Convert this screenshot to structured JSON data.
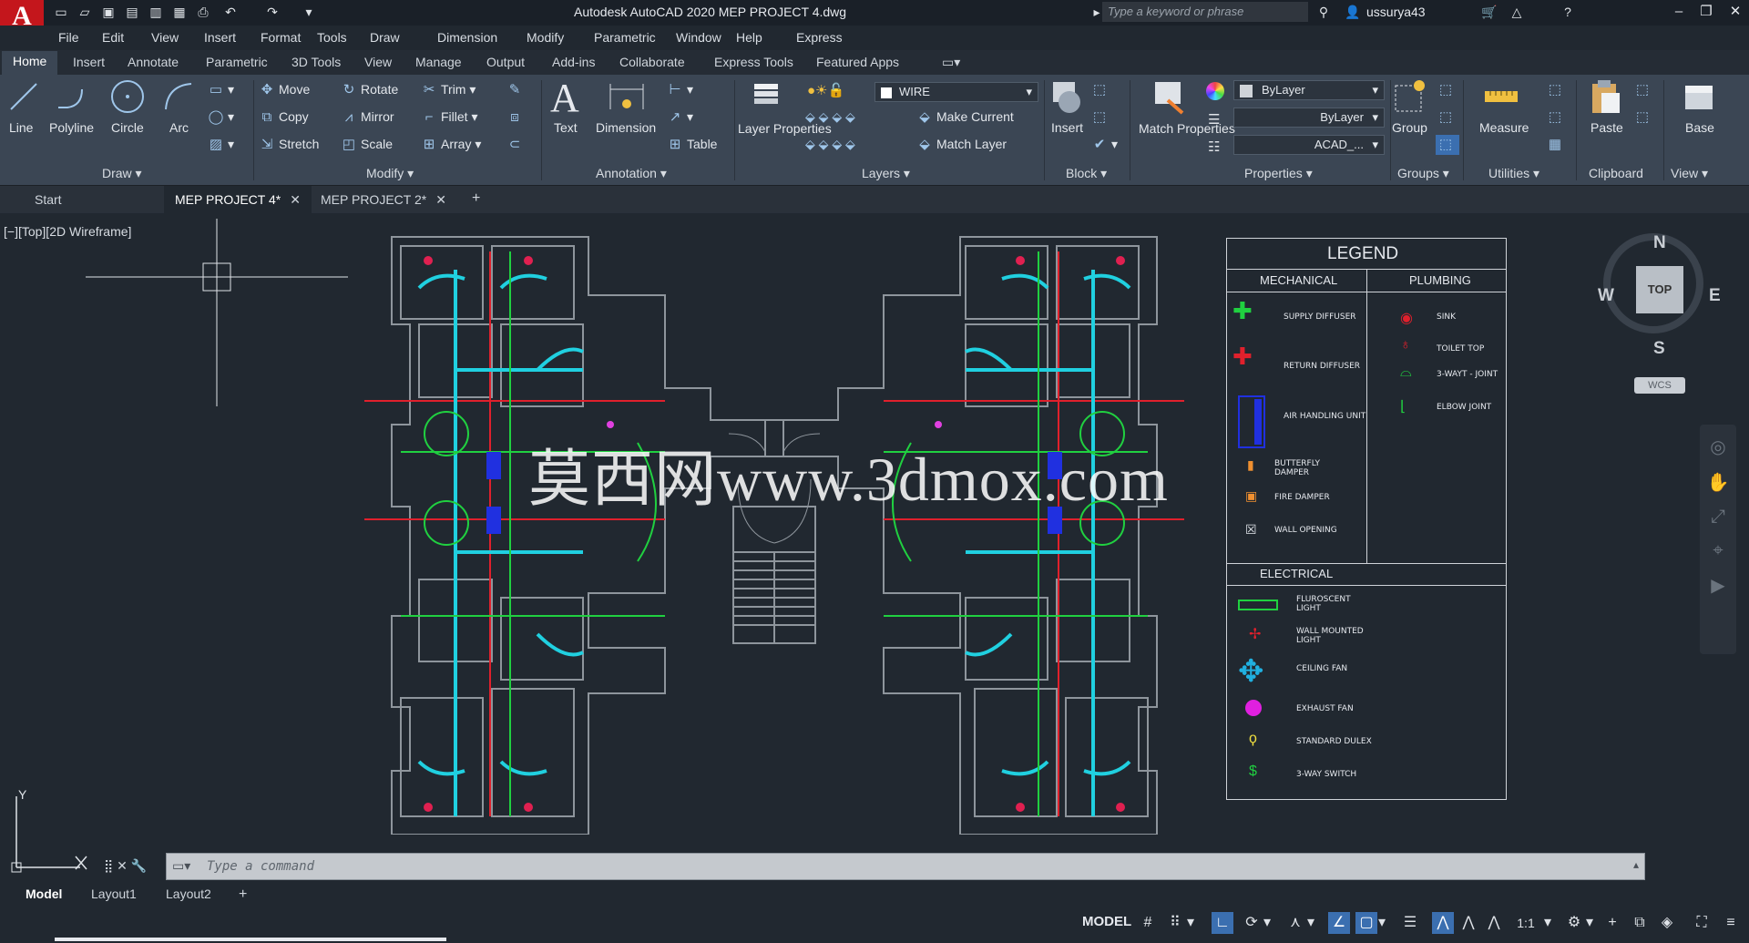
{
  "app": {
    "logo": "A",
    "title": "Autodesk AutoCAD 2020    MEP PROJECT 4.dwg",
    "search_placeholder": "Type a keyword or phrase",
    "username": "ussurya43"
  },
  "menu": [
    "File",
    "Edit",
    "View",
    "Insert",
    "Format",
    "Tools",
    "Draw",
    "Dimension",
    "Modify",
    "Parametric",
    "Window",
    "Help",
    "Express"
  ],
  "ribbon_tabs": [
    "Home",
    "Insert",
    "Annotate",
    "Parametric",
    "3D Tools",
    "View",
    "Manage",
    "Output",
    "Add-ins",
    "Collaborate",
    "Express Tools",
    "Featured Apps"
  ],
  "ribbon": {
    "draw": {
      "title": "Draw",
      "line": "Line",
      "polyline": "Polyline",
      "circle": "Circle",
      "arc": "Arc"
    },
    "modify": {
      "title": "Modify",
      "move": "Move",
      "rotate": "Rotate",
      "trim": "Trim",
      "copy": "Copy",
      "mirror": "Mirror",
      "fillet": "Fillet",
      "stretch": "Stretch",
      "scale": "Scale",
      "array": "Array"
    },
    "annotation": {
      "title": "Annotation",
      "text": "Text",
      "dimension": "Dimension",
      "table": "Table"
    },
    "layers": {
      "title": "Layers",
      "layer_properties": "Layer Properties",
      "current_layer": "WIRE",
      "make_current": "Make Current",
      "match_layer": "Match Layer"
    },
    "block": {
      "title": "Block",
      "insert": "Insert"
    },
    "properties": {
      "title": "Properties",
      "match_properties": "Match Properties",
      "color": "ByLayer",
      "lineweight": "ByLayer",
      "linetype": "ACAD_..."
    },
    "groups": {
      "title": "Groups",
      "group": "Group"
    },
    "utilities": {
      "title": "Utilities",
      "measure": "Measure"
    },
    "clipboard": {
      "title": "Clipboard",
      "paste": "Paste"
    },
    "view": {
      "title": "View",
      "base": "Base"
    }
  },
  "file_tabs": [
    {
      "label": "Start"
    },
    {
      "label": "MEP PROJECT 4*"
    },
    {
      "label": "MEP PROJECT 2*"
    }
  ],
  "viewport_label": "[−][Top][2D Wireframe]",
  "viewcube": {
    "n": "N",
    "s": "S",
    "e": "E",
    "w": "W",
    "face": "TOP",
    "wcs": "WCS"
  },
  "ucs": {
    "y": "Y"
  },
  "watermark": "莫西网www.3dmox.com",
  "legend": {
    "title": "LEGEND",
    "mechanical_head": "MECHANICAL",
    "plumbing_head": "PLUMBING",
    "electrical_head": "ELECTRICAL",
    "mechanical": [
      "SUPPLY DIFFUSER",
      "RETURN DIFFUSER",
      "AIR HANDLING UNIT",
      "BUTTERFLY DAMPER",
      "FIRE DAMPER",
      "WALL OPENING"
    ],
    "plumbing": [
      "SINK",
      "TOILET TOP",
      "3-WAYT - JOINT",
      "ELBOW JOINT"
    ],
    "electrical": [
      "FLUROSCENT LIGHT",
      "WALL MOUNTED LIGHT",
      "CEILING FAN",
      "EXHAUST FAN",
      "STANDARD DULEX",
      "3-WAY SWITCH"
    ]
  },
  "command_placeholder": "Type a command",
  "layout_tabs": [
    "Model",
    "Layout1",
    "Layout2"
  ],
  "status": {
    "model": "MODEL",
    "scale": "1:1"
  },
  "colors": {
    "accent": "#3b6fb0",
    "ribbon": "#3b4654",
    "canvas": "#212830",
    "logo": "#c4161c"
  }
}
